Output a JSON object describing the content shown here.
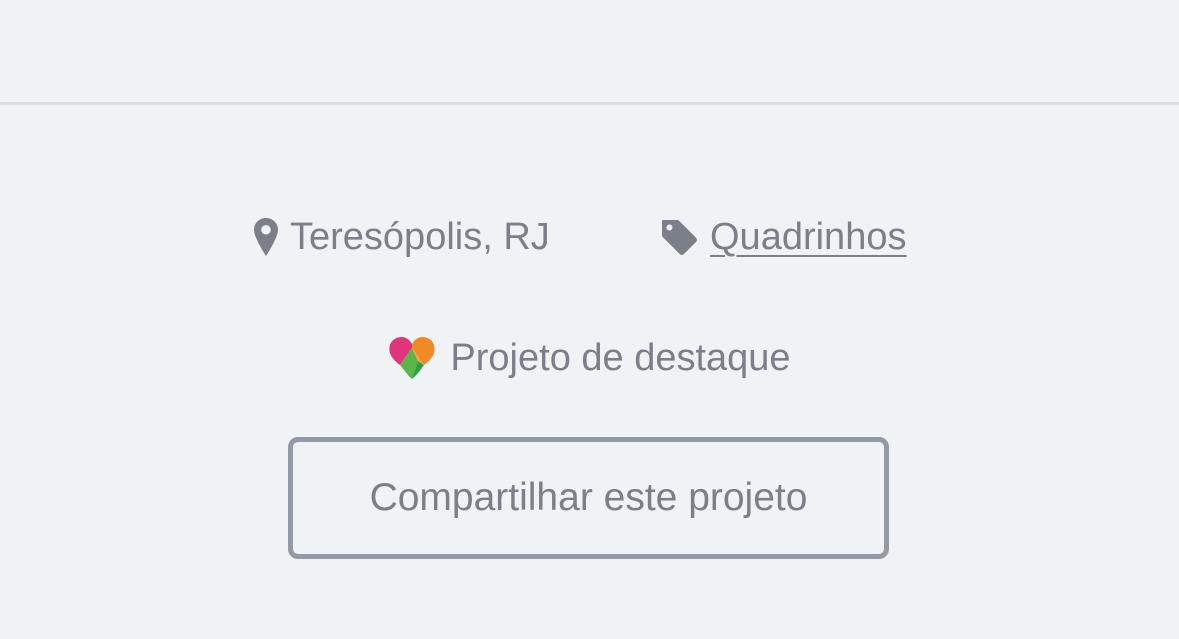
{
  "project_meta": {
    "location": "Teresópolis, RJ",
    "location_icon": "map-pin-icon",
    "category": "Quadrinhos",
    "category_icon": "tag-icon"
  },
  "badge": {
    "label": "Projeto de destaque",
    "icon": "featured-heart-icon",
    "icon_colors": [
      "#e0357c",
      "#f08a24",
      "#5ab646",
      "#2e9e49"
    ]
  },
  "share": {
    "label": "Compartilhar este projeto"
  },
  "colors": {
    "background": "#eff3f5",
    "text": "#7a7f89",
    "border": "#939aa5",
    "divider": "#dbdfe2"
  }
}
